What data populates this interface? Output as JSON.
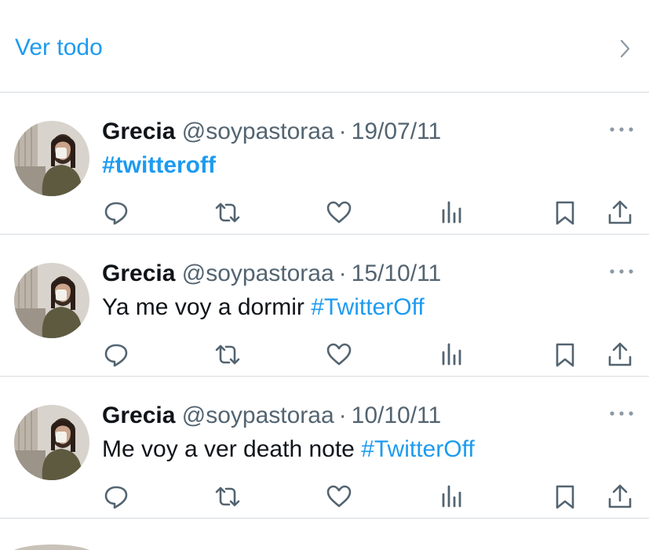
{
  "ver_todo": {
    "label": "Ver todo"
  },
  "tweets": [
    {
      "name": "Grecia",
      "handle": "@soypastoraa",
      "separator": "·",
      "date": "19/07/11",
      "text": "",
      "hashtag": "#twitteroff"
    },
    {
      "name": "Grecia",
      "handle": "@soypastoraa",
      "separator": "·",
      "date": "15/10/11",
      "text": "Ya me voy a dormir ",
      "hashtag": "#TwitterOff"
    },
    {
      "name": "Grecia",
      "handle": "@soypastoraa",
      "separator": "·",
      "date": "10/10/11",
      "text": "Me voy a ver death note ",
      "hashtag": "#TwitterOff"
    }
  ],
  "icons": {
    "chevron": "chevron-right-icon",
    "more": "more-dots-icon",
    "reply": "reply-icon",
    "retweet": "retweet-icon",
    "like": "heart-icon",
    "views": "views-icon",
    "bookmark": "bookmark-icon",
    "share": "share-icon"
  },
  "colors": {
    "accent": "#1d9bf0",
    "text": "#0f1419",
    "secondary": "#536471",
    "divider": "#d6dbdf"
  }
}
